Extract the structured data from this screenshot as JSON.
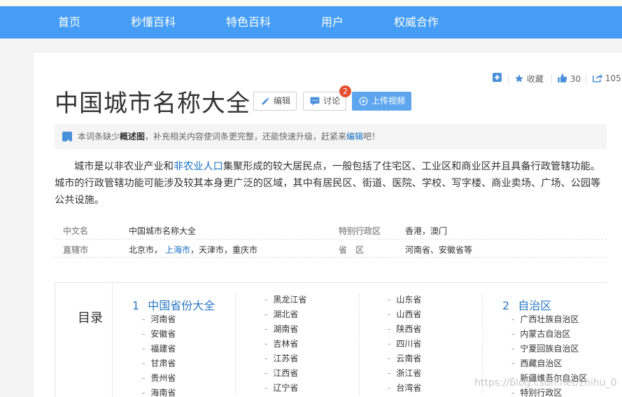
{
  "nav": {
    "items": [
      "首页",
      "秒懂百科",
      "特色百科",
      "用户",
      "权威合作"
    ]
  },
  "tools": {
    "collect_label": "收藏",
    "like_count": "30",
    "share_count": "105"
  },
  "entry": {
    "title": "中国城市名称大全",
    "edit_label": "编辑",
    "discuss_label": "讨论",
    "discuss_badge": "2",
    "upload_label": "上传视频"
  },
  "notice": {
    "text1": "本词条缺少",
    "bold": "概述图",
    "text2": "，补充相关内容使词条更完整，还能快速升级，赶紧来",
    "link": "编辑",
    "text3": "吧！"
  },
  "summary": {
    "p1": "城市是以非农业产业和",
    "link": "非农业人口",
    "p2": "集聚形成的较大居民点，一般包括了住宅区、工业区和商业区并且具备行政管辖功能。城市的行政管辖功能可能涉及较其本身更广泛的区域，其中有居民区、街道、医院、学校、写字楼、商业卖场、广场、公园等公共设施。"
  },
  "info": {
    "cn_name_label": "中文名",
    "cn_name_value": "中国城市名称大全",
    "sar_label": "特别行政区",
    "sar_value": "香港，澳门",
    "muni_label": "直辖市",
    "muni_v1": "北京市，",
    "muni_link": "上海市",
    "muni_v2": "，天津市，重庆市",
    "prov_label": "省　区",
    "prov_value": "河南省、安徽省等"
  },
  "toc": {
    "title": "目录",
    "s1_num": "1",
    "s1_title": "中国省份大全",
    "col1": [
      "河南省",
      "安徽省",
      "福建省",
      "甘肃省",
      "贵州省",
      "海南省"
    ],
    "col2": [
      "黑龙江省",
      "湖北省",
      "湖南省",
      "吉林省",
      "江苏省",
      "江西省",
      "辽宁省"
    ],
    "col3": [
      "山东省",
      "山西省",
      "陕西省",
      "四川省",
      "云南省",
      "浙江省",
      "台湾省"
    ],
    "s2_num": "2",
    "s2_title": "自治区",
    "col4": [
      "广西壮族自治区",
      "内蒙古自治区",
      "宁夏回族自治区",
      "西藏自治区",
      "新疆维吾尔自治区",
      "特别行政区"
    ]
  },
  "watermark": "https://blog.csdn.net/zhihu_0"
}
